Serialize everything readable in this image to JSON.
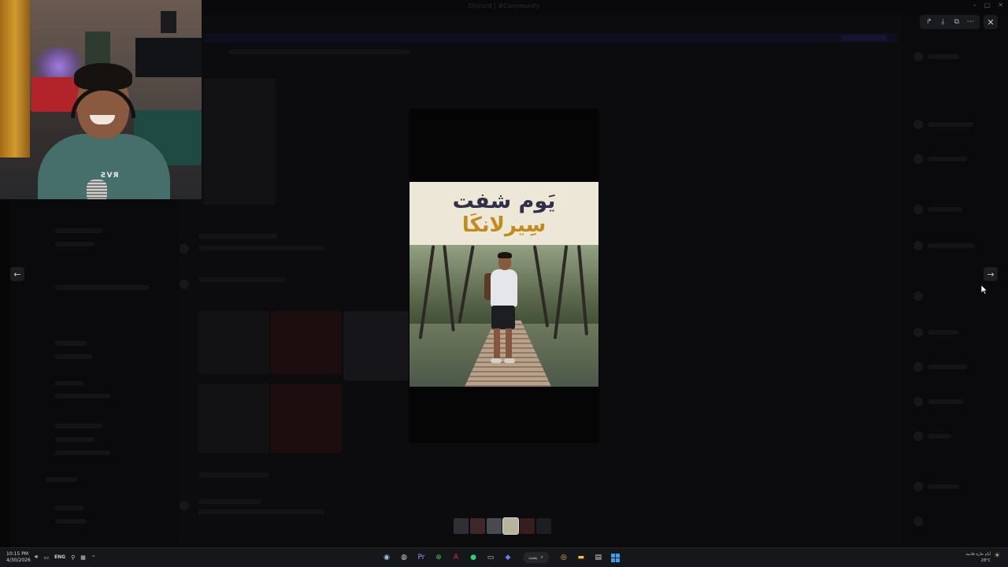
{
  "window": {
    "title": "Discord | #Community",
    "controls": [
      "–",
      "▢",
      "✕"
    ]
  },
  "viewer": {
    "toolbar": [
      {
        "name": "forward-icon",
        "glyph": "↱"
      },
      {
        "name": "download-icon",
        "glyph": "⤓"
      },
      {
        "name": "open-external-icon",
        "glyph": "⧉"
      },
      {
        "name": "more-icon",
        "glyph": "⋯"
      }
    ],
    "close_glyph": "✕",
    "prev_glyph": "←",
    "next_glyph": "→"
  },
  "media": {
    "title_line1": "يَوم شفت",
    "title_line2": "سِيرلانكَا",
    "colors": {
      "header_bg": "#ece7d6",
      "line1": "#2f2f49",
      "line2": "#c38b1c"
    }
  },
  "thumbnails": [
    {
      "color": "#4b4e55",
      "active": false
    },
    {
      "color": "#6a3c44",
      "active": false
    },
    {
      "color": "#7d8083",
      "active": false
    },
    {
      "color": "#b8b39c",
      "active": true
    },
    {
      "color": "#5c2b2b",
      "active": false
    },
    {
      "color": "#2b2d33",
      "active": false
    }
  ],
  "webcam": {
    "shirt_logo": "ƧVЯ"
  },
  "taskbar": {
    "time": "10:15 PM",
    "date": "4/30/2026",
    "language": "ENG",
    "search_label": "بحث",
    "weather_text": "أيام حارة قادمة",
    "temperature": "28°C",
    "apps": [
      {
        "name": "steam-icon",
        "glyph": "◉",
        "color": "#9fc3e8"
      },
      {
        "name": "obs-icon",
        "glyph": "◍",
        "color": "#d0d0d0"
      },
      {
        "name": "premiere-icon",
        "glyph": "Pr",
        "color": "#9b8cff"
      },
      {
        "name": "xbox-icon",
        "glyph": "⊗",
        "color": "#3fbf4f"
      },
      {
        "name": "acrobat-icon",
        "glyph": "A",
        "color": "#e3312d"
      },
      {
        "name": "spotify-icon",
        "glyph": "●",
        "color": "#2bd467"
      },
      {
        "name": "capture-icon",
        "glyph": "▭",
        "color": "#bfc3c8"
      },
      {
        "name": "discord-icon",
        "glyph": "◆",
        "color": "#6f7cf0"
      },
      {
        "name": "chrome-icon",
        "glyph": "◎",
        "color": "#f1c232"
      },
      {
        "name": "explorer-icon",
        "glyph": "▬",
        "color": "#f2c14e"
      },
      {
        "name": "notes-icon",
        "glyph": "▤",
        "color": "#d7d9dc"
      }
    ]
  }
}
